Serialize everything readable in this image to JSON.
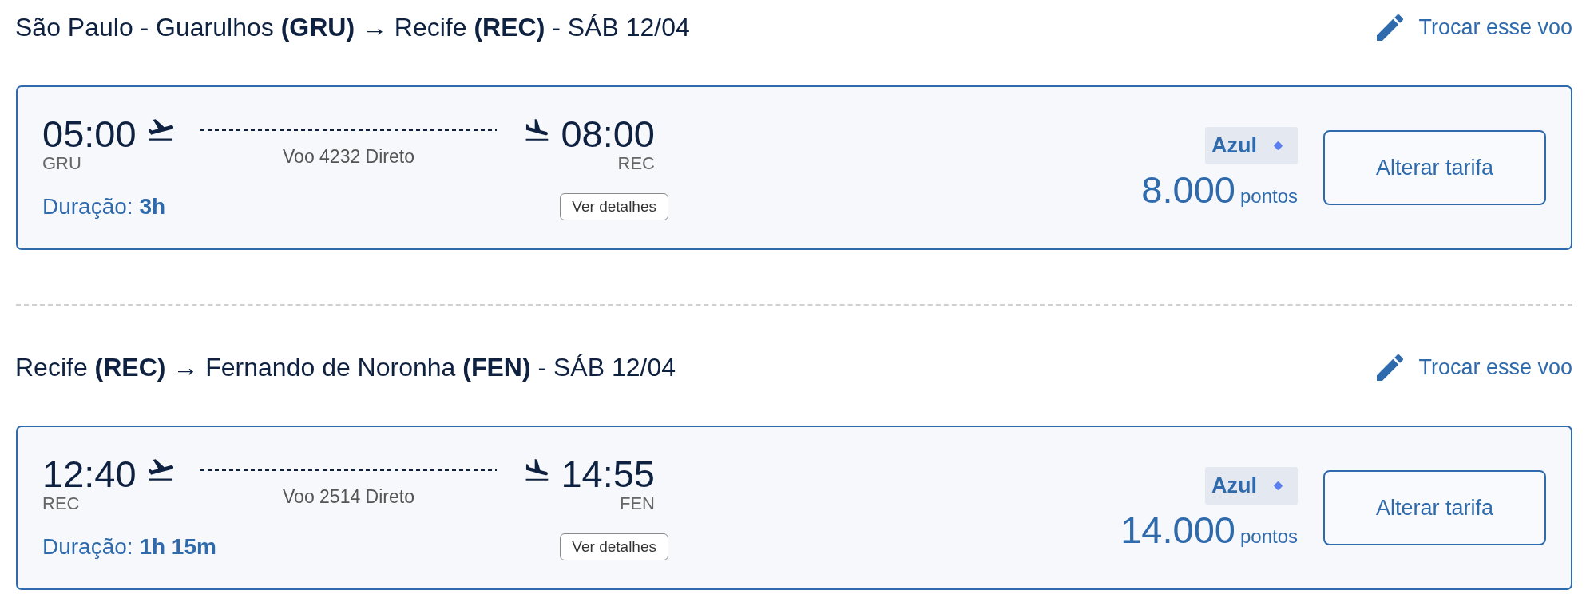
{
  "legs": [
    {
      "title": "São Paulo - Guarulhos **(GRU)** → Recife **(REC)** - SÁB 12/04",
      "change_link": "Trocar esse voo",
      "flight": {
        "departure": {
          "time": "05:00",
          "airport": "GRU"
        },
        "arrival": {
          "time": "08:00",
          "airport": "REC"
        },
        "flight_info": "Voo 4232 Direto",
        "duration": "Duração: **3h**",
        "details_button": "Ver detalhes"
      },
      "fare": {
        "airline": "Azul",
        "points": "8.000",
        "unit": "pontos",
        "button": "Alterar tarifa"
      }
    },
    {
      "title": "Recife **(REC)** → Fernando de Noronha **(FEN)** - SÁB 12/04",
      "change_link": "Trocar esse voo",
      "flight": {
        "departure": {
          "time": "12:40",
          "airport": "REC"
        },
        "arrival": {
          "time": "14:55",
          "airport": "FEN"
        },
        "flight_info": "Voo 2514 Direto",
        "duration": "Duração: **1h 15m**",
        "details_button": "Ver detalhes"
      },
      "fare": {
        "airline": "Azul",
        "points": "14.000",
        "unit": "pontos",
        "button": "Alterar tarifa"
      }
    }
  ]
}
